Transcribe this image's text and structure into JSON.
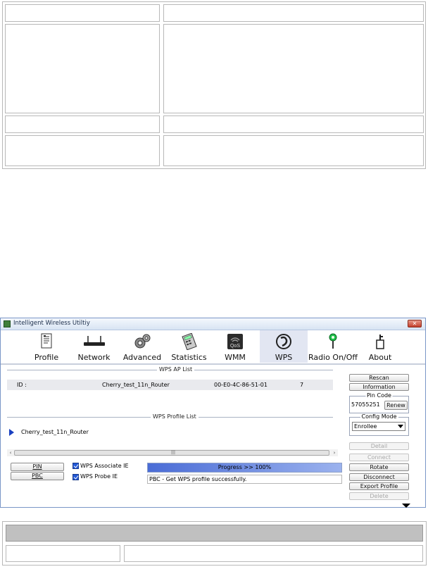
{
  "window": {
    "title": "Intelligent Wireless Utiltiy",
    "close_glyph": "✕"
  },
  "toolbar": {
    "items": [
      {
        "label": "Profile",
        "icon": "profile-icon"
      },
      {
        "label": "Network",
        "icon": "network-icon"
      },
      {
        "label": "Advanced",
        "icon": "advanced-icon"
      },
      {
        "label": "Statistics",
        "icon": "statistics-icon"
      },
      {
        "label": "WMM",
        "icon": "wmm-icon",
        "icon_text": "QoS"
      },
      {
        "label": "WPS",
        "icon": "wps-icon",
        "selected": true
      },
      {
        "label": "Radio On/Off",
        "icon": "radio-icon"
      },
      {
        "label": "About",
        "icon": "about-icon"
      }
    ]
  },
  "wps_ap_list": {
    "title": "WPS AP List",
    "rows": [
      {
        "id_label": "ID :",
        "ssid": "Cherry_test_11n_Router",
        "bssid": "00-E0-4C-86-51-01",
        "channel": "7"
      }
    ]
  },
  "wps_profile_list": {
    "title": "WPS Profile List",
    "items": [
      "Cherry_test_11n_Router"
    ]
  },
  "scrollbar": {
    "left_arrow": "‹",
    "right_arrow": "›",
    "grip": "|||"
  },
  "buttons": {
    "pin": "PIN",
    "pbc": "PBC",
    "rescan": "Rescan",
    "information": "Information",
    "renew": "Renew",
    "detail": "Detail",
    "connect": "Connect",
    "rotate": "Rotate",
    "disconnect": "Disconnect",
    "export_profile": "Export Profile",
    "delete": "Delete"
  },
  "checkboxes": {
    "associate_ie": {
      "label": "WPS Associate IE",
      "checked": true
    },
    "probe_ie": {
      "label": "WPS Probe IE",
      "checked": true
    }
  },
  "progress": {
    "text": "Progress >> 100%",
    "value": 1.0
  },
  "status_text": "PBC - Get WPS profile successfully.",
  "pin_code": {
    "legend": "Pin Code",
    "value": "57055251"
  },
  "config_mode": {
    "legend": "Config Mode",
    "selected": "Enrollee"
  },
  "colors": {
    "accent": "#2259d8",
    "selected_tab": "#e2e6f2",
    "progress": "#4a6cd6"
  }
}
